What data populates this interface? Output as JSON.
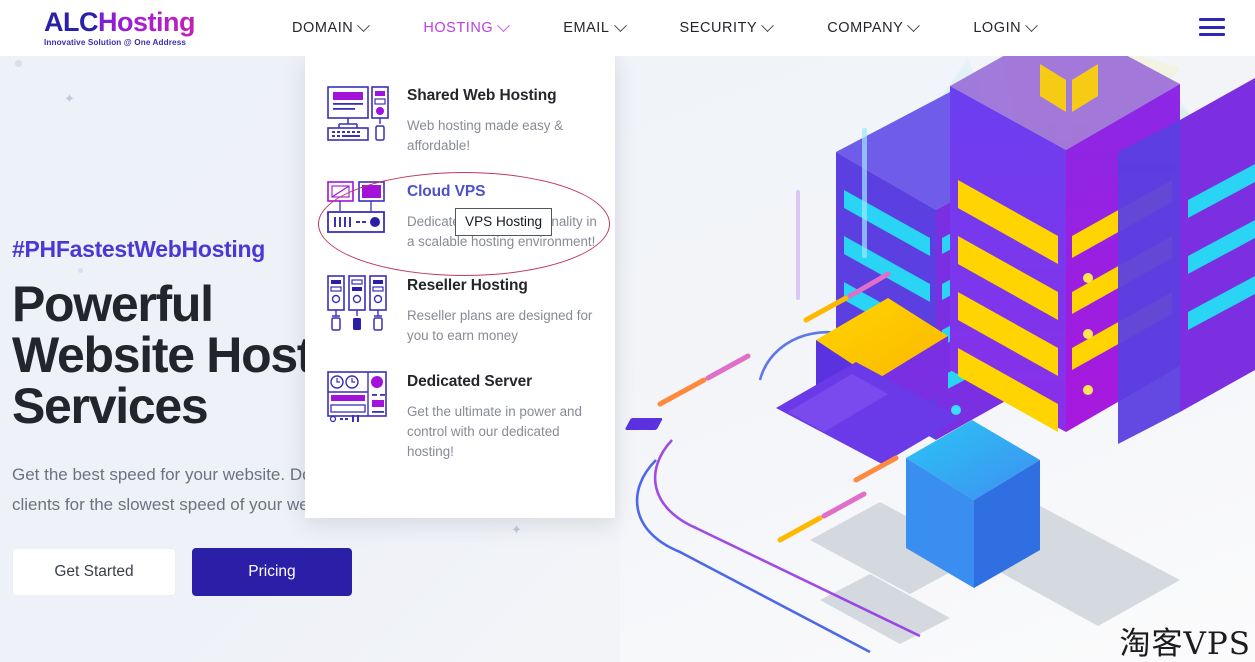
{
  "brand": {
    "logo_primary": "ALC",
    "logo_secondary": "Hosting",
    "tagline": "Innovative Solution @ One Address",
    "color_primary": "#2b21a8",
    "color_accent": "#bb3fe0"
  },
  "nav": {
    "items": [
      {
        "label": "DOMAIN",
        "active": false,
        "has_caret": true
      },
      {
        "label": "HOSTING",
        "active": true,
        "has_caret": true
      },
      {
        "label": "EMAIL",
        "active": false,
        "has_caret": true
      },
      {
        "label": "SECURITY",
        "active": false,
        "has_caret": true
      },
      {
        "label": "COMPANY",
        "active": false,
        "has_caret": true
      },
      {
        "label": "LOGIN",
        "active": false,
        "has_caret": true
      }
    ],
    "menu_icon": "hamburger-menu-icon"
  },
  "dropdown": {
    "open_for": "HOSTING",
    "items": [
      {
        "title": "Shared Web Hosting",
        "desc": "Web hosting made easy & affordable!",
        "icon": "desktop-computer-icon",
        "highlighted": false
      },
      {
        "title": "Cloud VPS",
        "desc": "Dedicated server functionality in a scalable hosting environment!",
        "icon": "vps-server-icon",
        "highlighted": true
      },
      {
        "title": "Reseller Hosting",
        "desc": "Reseller plans are designed for you to earn money",
        "icon": "server-racks-icon",
        "highlighted": false
      },
      {
        "title": "Dedicated Server",
        "desc": "Get the ultimate in power and control with our dedicated hosting!",
        "icon": "dedicated-server-icon",
        "highlighted": false
      }
    ]
  },
  "tooltip": {
    "text": "VPS Hosting"
  },
  "annotation": {
    "shape": "ellipse",
    "color": "#c0395a"
  },
  "hero": {
    "hashtag": "#PHFastestWebHosting",
    "title_line1": "Powerful",
    "title_line2": "Website Hosting",
    "title_line3": "Services",
    "subtitle_line1": "Get the best speed for your website. Don't blame your",
    "subtitle_line2": "clients for the slowest speed of your website.",
    "buttons": [
      {
        "label": "Get Started",
        "style": "ghost"
      },
      {
        "label": "Pricing",
        "style": "primary"
      }
    ]
  },
  "illustration": {
    "name": "isometric-datacenter-illustration",
    "elements": [
      "server-towers",
      "laptop",
      "tablet",
      "light-rays",
      "network-cables"
    ]
  },
  "watermark": {
    "text": "淘客VPS"
  }
}
